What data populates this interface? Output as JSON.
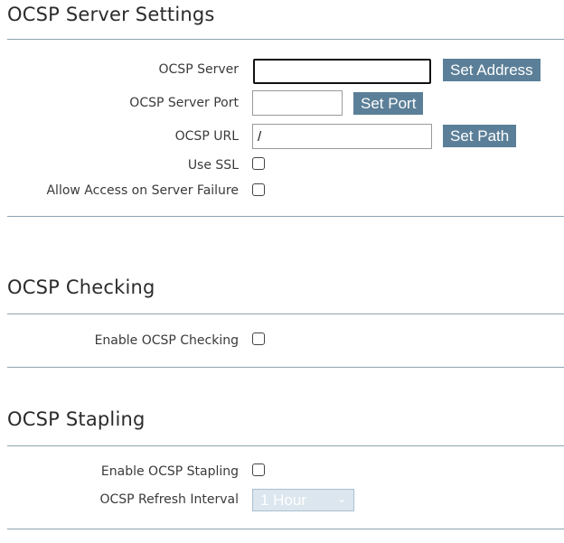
{
  "server_settings": {
    "title": "OCSP Server Settings",
    "server_label": "OCSP Server",
    "server_value": "",
    "set_address_label": "Set Address",
    "port_label": "OCSP Server Port",
    "port_value": "",
    "set_port_label": "Set Port",
    "url_label": "OCSP URL",
    "url_value": "/",
    "set_path_label": "Set Path",
    "use_ssl_label": "Use SSL",
    "allow_access_label": "Allow Access on Server Failure"
  },
  "checking": {
    "title": "OCSP Checking",
    "enable_label": "Enable OCSP Checking"
  },
  "stapling": {
    "title": "OCSP Stapling",
    "enable_label": "Enable OCSP Stapling",
    "refresh_label": "OCSP Refresh Interval",
    "refresh_value": "1 Hour"
  }
}
